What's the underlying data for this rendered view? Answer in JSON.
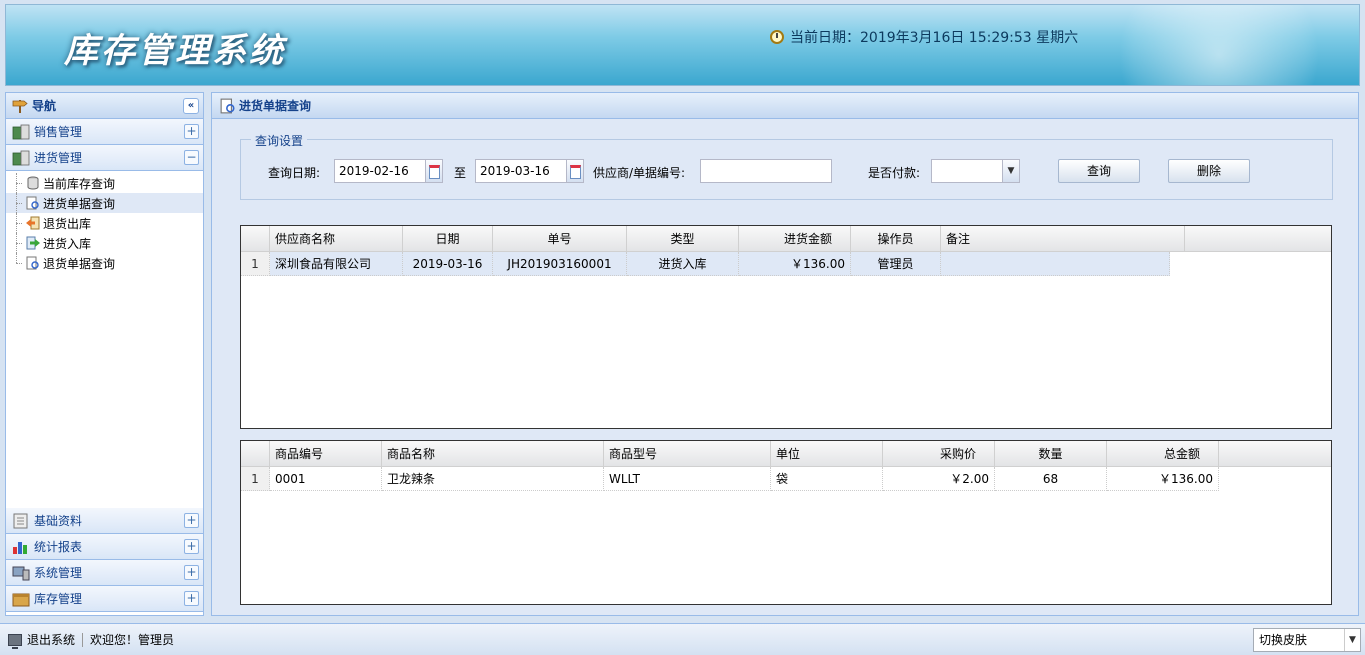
{
  "header": {
    "app_title": "库存管理系统",
    "clock_text": "当前日期：2019年3月16日 15:29:53 星期六"
  },
  "nav": {
    "title": "导航",
    "collapse_glyph": "«",
    "sections_top": [
      {
        "label": "销售管理",
        "toggle": "+",
        "icon": "sales-icon"
      },
      {
        "label": "进货管理",
        "toggle": "−",
        "icon": "purchase-icon"
      }
    ],
    "tree": [
      {
        "label": "当前库存查询",
        "icon": "database-icon"
      },
      {
        "label": "进货单据查询",
        "icon": "document-search-icon"
      },
      {
        "label": "退货出库",
        "icon": "return-out-icon"
      },
      {
        "label": "进货入库",
        "icon": "stock-in-icon"
      },
      {
        "label": "退货单据查询",
        "icon": "document-search-icon"
      }
    ],
    "sections_bottom": [
      {
        "label": "基础资料",
        "toggle": "+",
        "icon": "basic-data-icon"
      },
      {
        "label": "统计报表",
        "toggle": "+",
        "icon": "chart-icon"
      },
      {
        "label": "系统管理",
        "toggle": "+",
        "icon": "system-icon"
      },
      {
        "label": "库存管理",
        "toggle": "+",
        "icon": "inventory-icon"
      }
    ]
  },
  "main": {
    "title": "进货单据查询",
    "query": {
      "legend": "查询设置",
      "date_label": "查询日期:",
      "date_from": "2019-02-16",
      "to_label": "至",
      "date_to": "2019-03-16",
      "supplier_label": "供应商/单据编号:",
      "supplier_value": "",
      "paid_label": "是否付款:",
      "paid_value": "",
      "search_button": "查询",
      "delete_button": "删除"
    },
    "orders": {
      "columns": [
        "供应商名称",
        "日期",
        "单号",
        "类型",
        "进货金额",
        "操作员",
        "备注"
      ],
      "rows": [
        {
          "index": "1",
          "supplier": "深圳食品有限公司",
          "date": "2019-03-16",
          "number": "JH201903160001",
          "type": "进货入库",
          "amount": "￥136.00",
          "operator": "管理员",
          "remark": ""
        }
      ]
    },
    "items": {
      "columns": [
        "商品编号",
        "商品名称",
        "商品型号",
        "单位",
        "采购价",
        "数量",
        "总金额"
      ],
      "rows": [
        {
          "index": "1",
          "code": "0001",
          "name": "卫龙辣条",
          "model": "WLLT",
          "unit": "袋",
          "price": "￥2.00",
          "qty": "68",
          "total": "￥136.00"
        }
      ]
    }
  },
  "footer": {
    "logout": "退出系统",
    "welcome": "欢迎您！管理员",
    "skin_select": "切换皮肤"
  }
}
